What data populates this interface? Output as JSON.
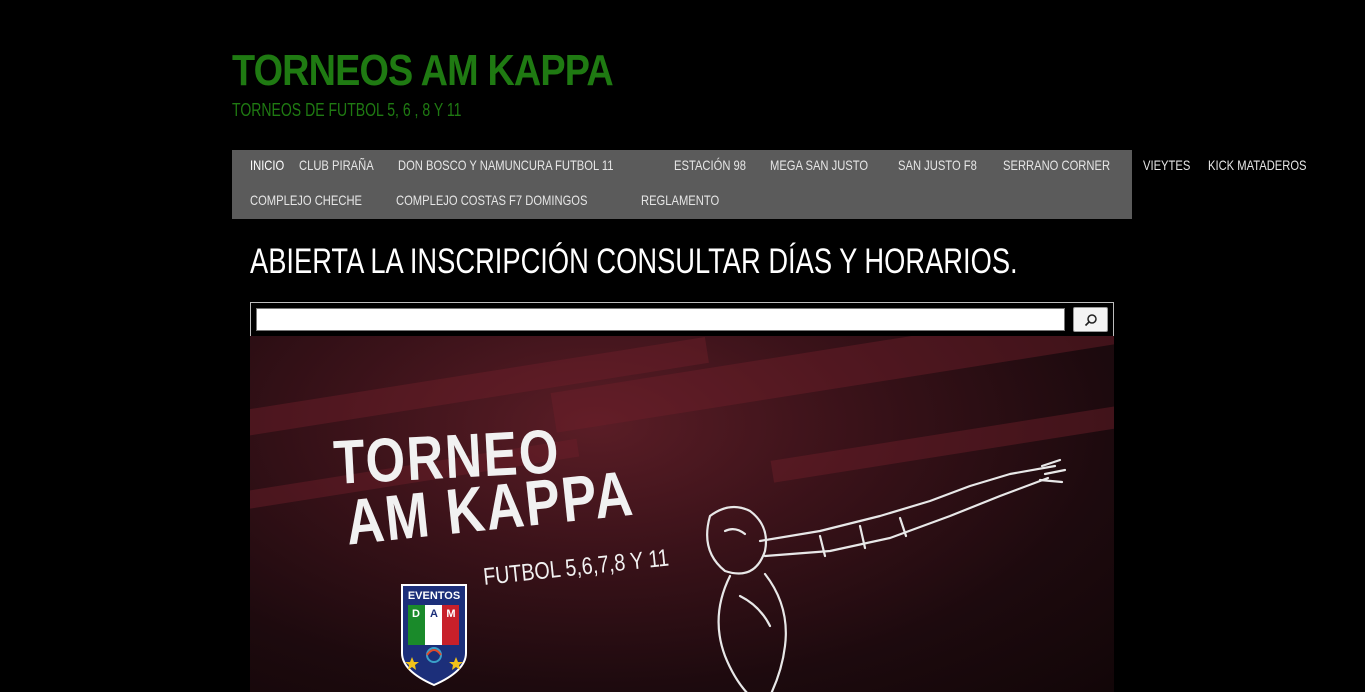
{
  "site": {
    "title": "TORNEOS AM KAPPA",
    "tagline": "TORNEOS DE FUTBOL 5, 6 , 8 Y 11"
  },
  "nav": {
    "row1": [
      "INICIO",
      "CLUB PIRAÑA",
      "DON BOSCO Y NAMUNCURA FUTBOL 11",
      "ESTACIÓN 98",
      "MEGA SAN JUSTO",
      "SAN JUSTO F8",
      "SERRANO CORNER",
      "VIEYTES",
      "KICK MATADEROS"
    ],
    "row2": [
      "COMPLEJO CHECHE",
      "COMPLEJO COSTAS F7 DOMINGOS",
      "REGLAMENTO"
    ]
  },
  "page": {
    "title": "ABIERTA LA INSCRIPCIÓN CONSULTAR DÍAS Y HORARIOS."
  },
  "search": {
    "value": "",
    "button_icon": "search-icon"
  },
  "banner": {
    "line1": "TORNEO",
    "line2": "AM KAPPA",
    "subtitle": "FUTBOL 5,6,7,8 Y 11",
    "badge_top": "EVENTOS",
    "badge_letters": [
      "D",
      "A",
      "M"
    ],
    "colors": {
      "green": "#1a8a2a",
      "red": "#c8202a",
      "navy": "#1c2f7a"
    }
  },
  "colors": {
    "title_green": "#1f7a12",
    "nav_bg": "#5b5b5b"
  }
}
